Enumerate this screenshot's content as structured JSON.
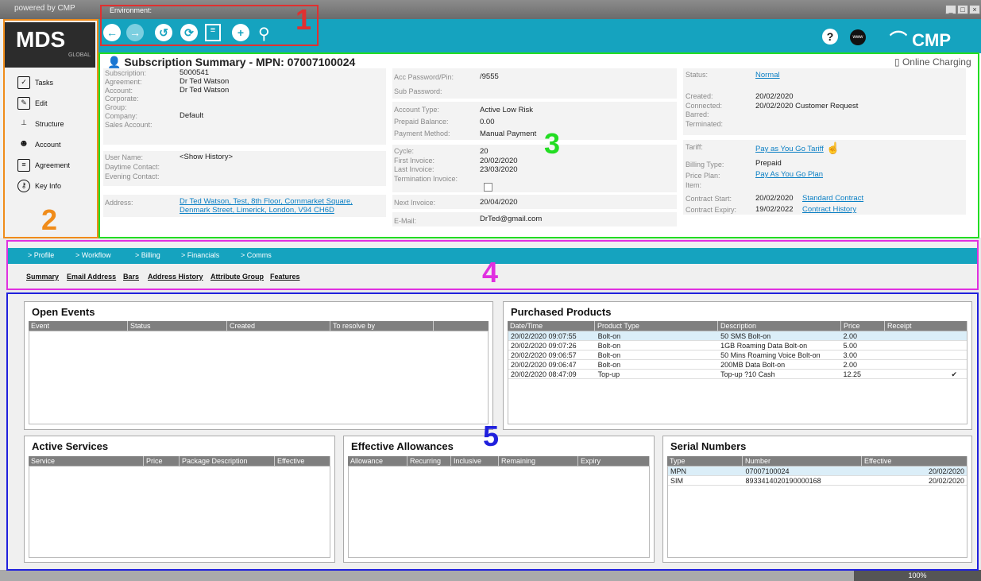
{
  "app": {
    "powered": "powered by CMP",
    "environment": "Environment:",
    "win_min": "_",
    "win_max": "□",
    "win_close": "×",
    "brand": "CMP",
    "help": "?",
    "www": "www"
  },
  "logo": {
    "main": "MDS",
    "sub": "GLOBAL"
  },
  "nav": [
    {
      "label": "Tasks",
      "icon": "tasks-icon"
    },
    {
      "label": "Edit",
      "icon": "edit-icon"
    },
    {
      "label": "Structure",
      "icon": "structure-icon"
    },
    {
      "label": "Account",
      "icon": "account-icon"
    },
    {
      "label": "Agreement",
      "icon": "agreement-icon"
    },
    {
      "label": "Key Info",
      "icon": "key-info-icon"
    }
  ],
  "summary": {
    "title": "Subscription Summary - MPN: 07007100024",
    "online_charging": "Online Charging",
    "col1": [
      [
        "Subscription:",
        "5000541"
      ],
      [
        "Agreement:",
        "Dr Ted Watson"
      ],
      [
        "Account:",
        "Dr Ted Watson"
      ],
      [
        "Corporate:",
        ""
      ],
      [
        "Group:",
        ""
      ],
      [
        "Company:",
        "Default"
      ],
      [
        "Sales Account:",
        ""
      ]
    ],
    "col1b": [
      [
        "User Name:",
        "<Show History>"
      ],
      [
        "Daytime Contact:",
        ""
      ],
      [
        "Evening Contact:",
        ""
      ]
    ],
    "address_label": "Address:",
    "address": "Dr Ted Watson, Test, 8th Floor, Cornmarket Square, Denmark Street, Limerick, London, V94 CH6D",
    "col2a": [
      [
        "Acc Password/Pin:",
        "/9555"
      ],
      [
        "Sub Password:",
        ""
      ]
    ],
    "col2b": [
      [
        "Account Type:",
        "Active Low Risk"
      ],
      [
        "Prepaid Balance:",
        "0.00"
      ],
      [
        "Payment Method:",
        "Manual Payment"
      ]
    ],
    "col2c": [
      [
        "Cycle:",
        "20"
      ],
      [
        "First Invoice:",
        "20/02/2020"
      ],
      [
        "Last Invoice:",
        "23/03/2020"
      ],
      [
        "Termination Invoice:",
        ""
      ]
    ],
    "next_invoice": [
      "Next Invoice:",
      "20/04/2020"
    ],
    "email": [
      "E-Mail:",
      "DrTed@gmail.com"
    ],
    "status_label": "Status:",
    "status": "Normal",
    "col3a": [
      [
        "Created:",
        "20/02/2020"
      ],
      [
        "Connected:",
        "20/02/2020  Customer Request"
      ],
      [
        "Barred:",
        ""
      ],
      [
        "Terminated:",
        ""
      ]
    ],
    "tariff_label": "Tariff:",
    "tariff": "Pay as You Go Tariff",
    "billing_type": [
      "Billing Type:",
      "Prepaid"
    ],
    "price_plan_label": "Price Plan:",
    "price_plan": "Pay As You Go Plan",
    "item_label": "Item:",
    "contract_start_label": "Contract Start:",
    "contract_start": "20/02/2020",
    "contract_start_link": "Standard Contract",
    "contract_expiry_label": "Contract Expiry:",
    "contract_expiry": "19/02/2022",
    "contract_expiry_link": "Contract History"
  },
  "tabs": [
    "Profile",
    "Workflow",
    "Billing",
    "Financials",
    "Comms"
  ],
  "subtabs": [
    "Summary",
    "Email Address",
    "Bars",
    "Address History",
    "Attribute Group",
    "Features"
  ],
  "open_events": {
    "title": "Open Events",
    "cols": [
      "Event",
      "Status",
      "Created",
      "To resolve by"
    ]
  },
  "purchased": {
    "title": "Purchased Products",
    "cols": [
      "Date/Time",
      "Product Type",
      "Description",
      "Price",
      "Receipt"
    ],
    "rows": [
      [
        "20/02/2020  09:07:55",
        "Bolt-on",
        "50 SMS Bolt-on",
        "2.00",
        ""
      ],
      [
        "20/02/2020  09:07:26",
        "Bolt-on",
        "1GB Roaming Data Bolt-on",
        "5.00",
        ""
      ],
      [
        "20/02/2020  09:06:57",
        "Bolt-on",
        "50 Mins Roaming Voice Bolt-on",
        "3.00",
        ""
      ],
      [
        "20/02/2020  09:06:47",
        "Bolt-on",
        "200MB Data Bolt-on",
        "2.00",
        ""
      ],
      [
        "20/02/2020  08:47:09",
        "Top-up",
        "Top-up ?10 Cash",
        "12.25",
        "✔"
      ]
    ]
  },
  "active_services": {
    "title": "Active Services",
    "cols": [
      "Service",
      "Price",
      "Package Description",
      "Effective"
    ]
  },
  "allowances": {
    "title": "Effective Allowances",
    "cols": [
      "Allowance",
      "Recurring",
      "Inclusive",
      "Remaining",
      "Expiry"
    ]
  },
  "serials": {
    "title": "Serial Numbers",
    "cols": [
      "Type",
      "Number",
      "Effective"
    ],
    "rows": [
      [
        "MPN",
        "07007100024",
        "20/02/2020"
      ],
      [
        "SIM",
        "8933414020190000168",
        "20/02/2020"
      ]
    ]
  },
  "zoom": "100%",
  "callouts": [
    "1",
    "2",
    "3",
    "4",
    "5"
  ]
}
